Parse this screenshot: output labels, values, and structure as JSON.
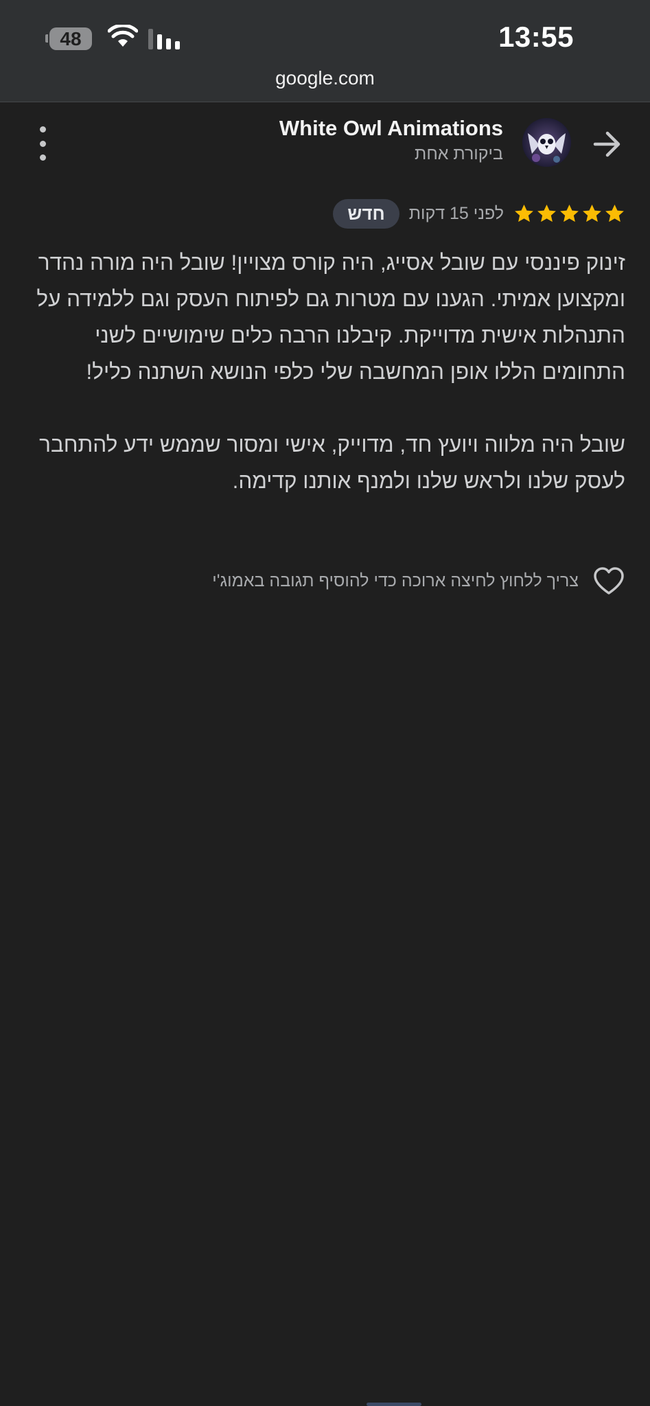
{
  "status_bar": {
    "battery_level": "48",
    "time": "13:55"
  },
  "browser": {
    "url": "google.com"
  },
  "header": {
    "business_name": "White Owl Animations",
    "review_count": "ביקורת אחת"
  },
  "review": {
    "rating": 5,
    "time_ago": "לפני 15 דקות",
    "badge": "חדש",
    "paragraph_1": "זינוק פיננסי עם שובל אסייג, היה קורס מצויין! שובל היה מורה נהדר ומקצוען אמיתי. הגענו עם מטרות גם לפיתוח העסק וגם ללמידה על התנהלות אישית מדוייקת. קיבלנו הרבה כלים שימושיים לשני התחומים הללו אופן המחשבה שלי כלפי הנושא השתנה כליל!",
    "paragraph_2": "שובל היה מלווה ויועץ חד, מדוייק, אישי ומסור שממש ידע להתחבר לעסק שלנו ולראש שלנו ולמנף אותנו קדימה."
  },
  "reaction": {
    "hint": "צריך ללחוץ לחיצה ארוכה כדי להוסיף תגובה באמוג'י"
  },
  "colors": {
    "background": "#1f1f1f",
    "chrome": "#2f3133",
    "star": "#fbbc04",
    "badge": "#3b3f4a"
  },
  "icons": [
    "battery-icon",
    "wifi-icon",
    "signal-icon",
    "more-vert-icon",
    "avatar",
    "arrow-forward-icon",
    "star-icon",
    "heart-outline-icon"
  ]
}
